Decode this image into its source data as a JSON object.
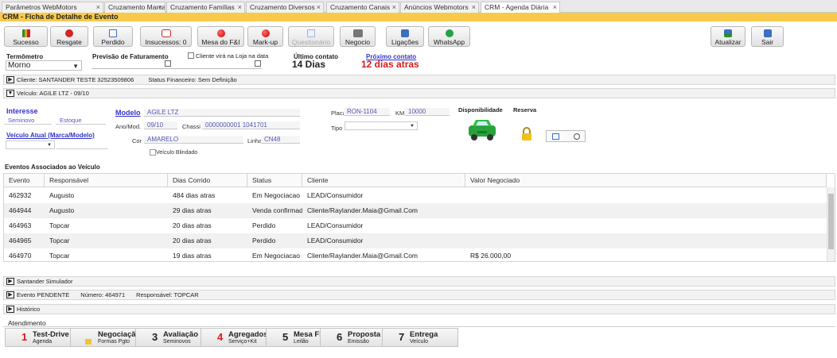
{
  "tabs": [
    {
      "label": "Parâmetros WebMotors"
    },
    {
      "label": "Cruzamento Marcas"
    },
    {
      "label": "Cruzamento Famílias"
    },
    {
      "label": "Cruzamento Diversos"
    },
    {
      "label": "Cruzamento Canais"
    },
    {
      "label": "Anúncios Webmotors"
    },
    {
      "label": "CRM - Agenda Diária"
    }
  ],
  "tab_close": "×",
  "title": "CRM - Ficha de Detalhe de Evento",
  "toolbar": {
    "buttons": [
      {
        "label": "Sucesso",
        "icon": "chart-icon",
        "color": "#2d8c2d"
      },
      {
        "label": "Resgate",
        "icon": "stop-icon",
        "color": "#d22525"
      },
      {
        "label": "Perdido",
        "icon": "document-icon",
        "color": "#3a6fc2"
      },
      {
        "label": "Insucessos: 0",
        "icon": "phone-icon",
        "color": "#d22525"
      },
      {
        "label": "Mesa do F&I",
        "icon": "red-dot-icon",
        "color": "#e01c1c"
      },
      {
        "label": "Mark-up",
        "icon": "red-dot-icon",
        "color": "#e01c1c"
      },
      {
        "label": "Questionário",
        "icon": "document-icon",
        "color": "#9ab4d8"
      },
      {
        "label": "Negocio",
        "icon": "printer-icon",
        "color": "#555555"
      },
      {
        "label": "Ligações",
        "icon": "list-icon",
        "color": "#3a6fc2"
      },
      {
        "label": "WhatsApp",
        "icon": "whatsapp-icon",
        "color": "#25a244"
      },
      {
        "label": "Atualizar",
        "icon": "refresh-icon",
        "color": "#2d8c2d"
      },
      {
        "label": "Sair",
        "icon": "exit-icon",
        "color": "#3a6fc2"
      }
    ]
  },
  "form": {
    "termometro_label": "Termômetro",
    "termometro_value": "Morno",
    "previsao_label": "Previsão de Faturamento",
    "cliente_loja_label": "Cliente virá na Loja na data",
    "ultimo_contato_label": "Último contato",
    "ultimo_contato_value": "14 Dias",
    "proximo_contato_label": "Próximo contato",
    "proximo_contato_value": "12 dias atras"
  },
  "sections": {
    "cliente": "Cliente: SANTANDER TESTE 32523509806",
    "status_financeiro": "Status Financeiro: Sem Definição",
    "veiculo": "Veículo: AGILE LTZ - 09/10",
    "santander": "Santander Simulador",
    "evento": "Evento PENDENTE",
    "numero": "Número: 464971",
    "responsavel": "Responsável: TOPCAR",
    "historico": "Histórico"
  },
  "vehicle": {
    "interesse_label": "Interesse",
    "seminovo": "Seminovo",
    "estoque": "Estoque",
    "veiculo_atual_label": "Veículo Atual (Marca/Modelo)",
    "modelo_label": "Modelo",
    "modelo_value": "AGILE LTZ",
    "anomod_label": "Ano/Mod.",
    "anomod_value": "09/10",
    "chassi_label": "Chassi",
    "chassi_value": "0000000001 1041701",
    "cor_label": "Cor",
    "cor_value": "AMARELO",
    "linha_label": "Linha",
    "linha_value": "CN48",
    "blindado_label": "Veículo Blindado",
    "placa_label": "Placa",
    "placa_value": "RON-1104",
    "km_label": "KM",
    "km_value": "10000",
    "tipo_label": "Tipo",
    "disponibilidade_label": "Disponibilidade",
    "reserva_label": "Reserva"
  },
  "events": {
    "title": "Eventos Associados ao Veículo",
    "columns": [
      "Evento",
      "Responsável",
      "Dias Corrido",
      "Status",
      "Cliente",
      "Valor Negociado"
    ],
    "rows": [
      {
        "evento": "462932",
        "responsavel": "Augusto",
        "dias": "484 dias atras",
        "status": "Em Negociacao",
        "cliente": "LEAD/Consumidor",
        "valor": ""
      },
      {
        "evento": "464944",
        "responsavel": "Augusto",
        "dias": "29 dias atras",
        "status": "Venda confirmada",
        "cliente": "Cliente/Raylander.Maia@Gmail.Com",
        "valor": ""
      },
      {
        "evento": "464963",
        "responsavel": "Topcar",
        "dias": "20 dias atras",
        "status": "Perdido",
        "cliente": "LEAD/Consumidor",
        "valor": ""
      },
      {
        "evento": "464965",
        "responsavel": "Topcar",
        "dias": "20 dias atras",
        "status": "Perdido",
        "cliente": "LEAD/Consumidor",
        "valor": ""
      },
      {
        "evento": "464970",
        "responsavel": "Topcar",
        "dias": "19 dias atras",
        "status": "Em Negociacao",
        "cliente": "Cliente/Raylander.Maia@Gmail.Com",
        "valor": "R$ 26.000,00"
      }
    ]
  },
  "atendimento": {
    "label": "Atendimento",
    "steps": [
      {
        "num": "1",
        "title": "Test-Drive",
        "sub": "Agenda",
        "num_color": "#d81b1b"
      },
      {
        "num": "",
        "title": "Negociação",
        "sub": "Formas Pgto",
        "num_color": "#222222"
      },
      {
        "num": "3",
        "title": "Avaliação",
        "sub": "Seminovos",
        "num_color": "#222222"
      },
      {
        "num": "4",
        "title": "Agregados",
        "sub": "Serviço+Kit",
        "num_color": "#d81b1b"
      },
      {
        "num": "5",
        "title": "Mesa FI",
        "sub": "Leilão",
        "num_color": "#222222"
      },
      {
        "num": "6",
        "title": "Proposta",
        "sub": "Emissão",
        "num_color": "#222222"
      },
      {
        "num": "7",
        "title": "Entrega",
        "sub": "Veículo",
        "num_color": "#222222"
      }
    ]
  },
  "colors": {
    "accent_title": "#f9c94b",
    "link_blue": "#3333cc",
    "red_text": "#d81b1b"
  }
}
